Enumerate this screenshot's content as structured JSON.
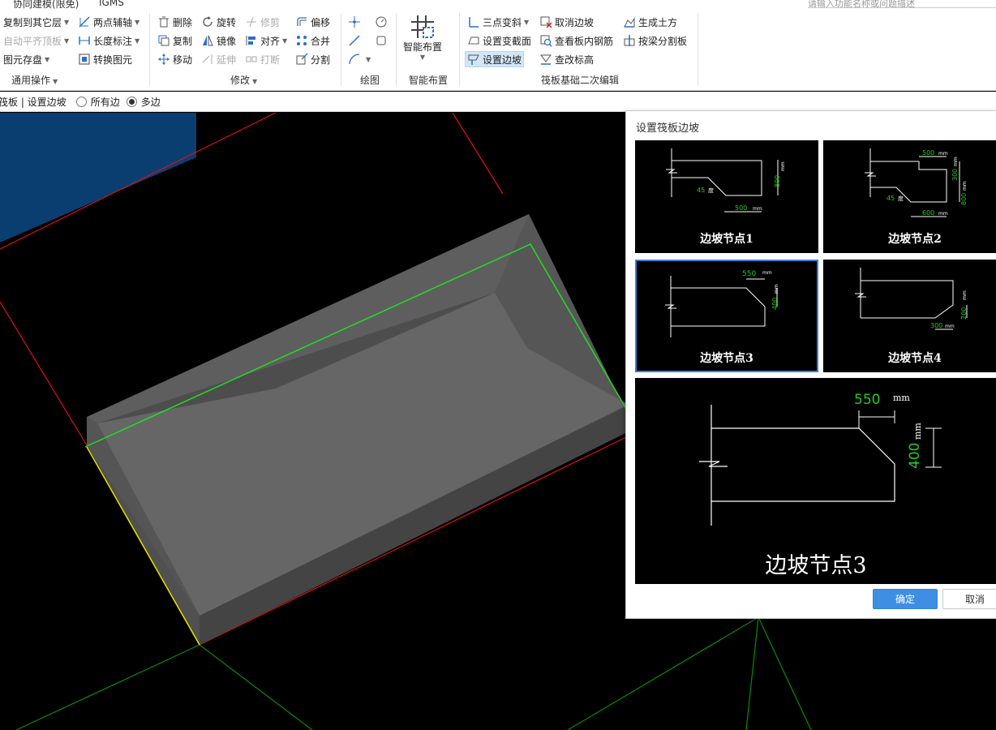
{
  "title_bar": {
    "tabs": [
      "协同建模(限免)",
      "IGMS"
    ],
    "search_placeholder": "请输入功能名称或问题描述"
  },
  "ribbon": {
    "groups": [
      {
        "label": "通用操作",
        "items": [
          "复制到其它层",
          "两点辅轴",
          "自动平齐顶板",
          "长度标注",
          "图元存盘",
          "转换图元"
        ]
      },
      {
        "label": "修改",
        "items": [
          "删除",
          "旋转",
          "修剪",
          "偏移",
          "复制",
          "镜像",
          "对齐",
          "合并",
          "移动",
          "延伸",
          "打断",
          "分割"
        ]
      },
      {
        "label": "绘图",
        "items": []
      },
      {
        "label": "智能布置",
        "items": [
          "智能布置"
        ]
      },
      {
        "label": "筏板基础二次编辑",
        "items": [
          "三点变斜",
          "取消边坡",
          "生成土方",
          "设置变截面",
          "查看板内钢筋",
          "按梁分割板",
          "设置边坡",
          "查改标高"
        ]
      }
    ]
  },
  "status_bar": {
    "breadcrumb": "筏板 | 设置边坡",
    "options": [
      {
        "label": "所有边",
        "selected": false
      },
      {
        "label": "多边",
        "selected": true
      }
    ]
  },
  "dialog": {
    "title": "设置筏板边坡",
    "nodes": [
      {
        "caption": "边坡节点1",
        "dims": [
          "45",
          "度",
          "800",
          "mm",
          "500",
          "mm"
        ]
      },
      {
        "caption": "边坡节点2",
        "dims": [
          "500",
          "mm",
          "45",
          "度",
          "600",
          "mm",
          "300",
          "mm",
          "800",
          "mm"
        ]
      },
      {
        "caption": "边坡节点3",
        "dims": [
          "550",
          "mm",
          "400",
          "mm"
        ],
        "selected": true
      },
      {
        "caption": "边坡节点4",
        "dims": [
          "300",
          "mm",
          "200",
          "mm"
        ]
      }
    ],
    "preview": {
      "caption": "边坡节点3",
      "dim_w": "550",
      "dim_h": "400",
      "unit": "mm"
    },
    "ok_label": "确定",
    "cancel_label": "取消"
  },
  "colors": {
    "dim_green": "#22cc22",
    "slab_top": "#666666",
    "axis_red": "#e01010",
    "axis_green": "#0a8a0a",
    "selected_edge": "#f0e000",
    "primary_button": "#3e8ee4",
    "selected_outline": "#3c7fd8"
  }
}
